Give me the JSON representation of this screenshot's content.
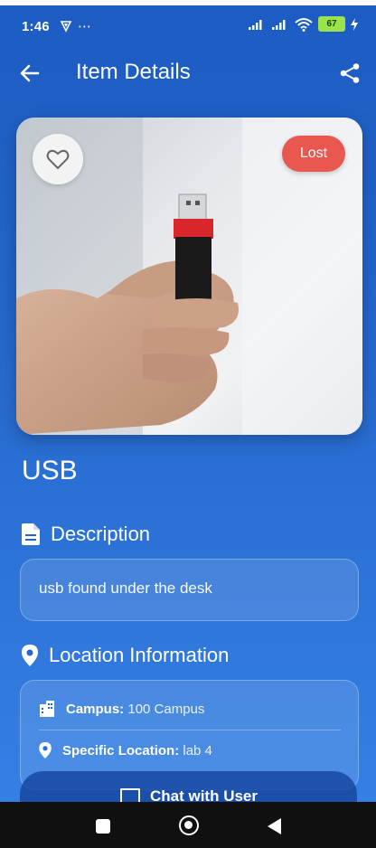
{
  "status_bar": {
    "time": "1:46",
    "extra_icons": "⋯",
    "battery": "67"
  },
  "app_bar": {
    "title": "Item Details",
    "back_icon": "arrow-left-icon",
    "share_icon": "share-icon"
  },
  "item": {
    "name": "USB",
    "status": "Lost",
    "status_color": "#e8584f",
    "favorite_icon": "heart-outline-icon"
  },
  "description": {
    "heading": "Description",
    "text": "usb found under the desk"
  },
  "location": {
    "heading": "Location Information",
    "campus_label": "Campus:",
    "campus_value": "100 Campus",
    "specific_label": "Specific Location:",
    "specific_value": "lab 4"
  },
  "chat_button": {
    "label": "Chat with User"
  },
  "colors": {
    "background_top": "#1d5cc2",
    "background_bottom": "#3582e6"
  }
}
